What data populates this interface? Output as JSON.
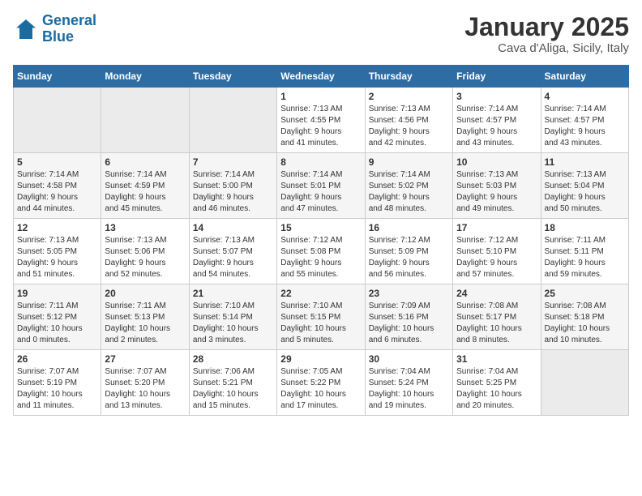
{
  "header": {
    "logo_line1": "General",
    "logo_line2": "Blue",
    "title": "January 2025",
    "subtitle": "Cava d'Aliga, Sicily, Italy"
  },
  "weekdays": [
    "Sunday",
    "Monday",
    "Tuesday",
    "Wednesday",
    "Thursday",
    "Friday",
    "Saturday"
  ],
  "weeks": [
    [
      {
        "day": "",
        "info": ""
      },
      {
        "day": "",
        "info": ""
      },
      {
        "day": "",
        "info": ""
      },
      {
        "day": "1",
        "info": "Sunrise: 7:13 AM\nSunset: 4:55 PM\nDaylight: 9 hours\nand 41 minutes."
      },
      {
        "day": "2",
        "info": "Sunrise: 7:13 AM\nSunset: 4:56 PM\nDaylight: 9 hours\nand 42 minutes."
      },
      {
        "day": "3",
        "info": "Sunrise: 7:14 AM\nSunset: 4:57 PM\nDaylight: 9 hours\nand 43 minutes."
      },
      {
        "day": "4",
        "info": "Sunrise: 7:14 AM\nSunset: 4:57 PM\nDaylight: 9 hours\nand 43 minutes."
      }
    ],
    [
      {
        "day": "5",
        "info": "Sunrise: 7:14 AM\nSunset: 4:58 PM\nDaylight: 9 hours\nand 44 minutes."
      },
      {
        "day": "6",
        "info": "Sunrise: 7:14 AM\nSunset: 4:59 PM\nDaylight: 9 hours\nand 45 minutes."
      },
      {
        "day": "7",
        "info": "Sunrise: 7:14 AM\nSunset: 5:00 PM\nDaylight: 9 hours\nand 46 minutes."
      },
      {
        "day": "8",
        "info": "Sunrise: 7:14 AM\nSunset: 5:01 PM\nDaylight: 9 hours\nand 47 minutes."
      },
      {
        "day": "9",
        "info": "Sunrise: 7:14 AM\nSunset: 5:02 PM\nDaylight: 9 hours\nand 48 minutes."
      },
      {
        "day": "10",
        "info": "Sunrise: 7:13 AM\nSunset: 5:03 PM\nDaylight: 9 hours\nand 49 minutes."
      },
      {
        "day": "11",
        "info": "Sunrise: 7:13 AM\nSunset: 5:04 PM\nDaylight: 9 hours\nand 50 minutes."
      }
    ],
    [
      {
        "day": "12",
        "info": "Sunrise: 7:13 AM\nSunset: 5:05 PM\nDaylight: 9 hours\nand 51 minutes."
      },
      {
        "day": "13",
        "info": "Sunrise: 7:13 AM\nSunset: 5:06 PM\nDaylight: 9 hours\nand 52 minutes."
      },
      {
        "day": "14",
        "info": "Sunrise: 7:13 AM\nSunset: 5:07 PM\nDaylight: 9 hours\nand 54 minutes."
      },
      {
        "day": "15",
        "info": "Sunrise: 7:12 AM\nSunset: 5:08 PM\nDaylight: 9 hours\nand 55 minutes."
      },
      {
        "day": "16",
        "info": "Sunrise: 7:12 AM\nSunset: 5:09 PM\nDaylight: 9 hours\nand 56 minutes."
      },
      {
        "day": "17",
        "info": "Sunrise: 7:12 AM\nSunset: 5:10 PM\nDaylight: 9 hours\nand 57 minutes."
      },
      {
        "day": "18",
        "info": "Sunrise: 7:11 AM\nSunset: 5:11 PM\nDaylight: 9 hours\nand 59 minutes."
      }
    ],
    [
      {
        "day": "19",
        "info": "Sunrise: 7:11 AM\nSunset: 5:12 PM\nDaylight: 10 hours\nand 0 minutes."
      },
      {
        "day": "20",
        "info": "Sunrise: 7:11 AM\nSunset: 5:13 PM\nDaylight: 10 hours\nand 2 minutes."
      },
      {
        "day": "21",
        "info": "Sunrise: 7:10 AM\nSunset: 5:14 PM\nDaylight: 10 hours\nand 3 minutes."
      },
      {
        "day": "22",
        "info": "Sunrise: 7:10 AM\nSunset: 5:15 PM\nDaylight: 10 hours\nand 5 minutes."
      },
      {
        "day": "23",
        "info": "Sunrise: 7:09 AM\nSunset: 5:16 PM\nDaylight: 10 hours\nand 6 minutes."
      },
      {
        "day": "24",
        "info": "Sunrise: 7:08 AM\nSunset: 5:17 PM\nDaylight: 10 hours\nand 8 minutes."
      },
      {
        "day": "25",
        "info": "Sunrise: 7:08 AM\nSunset: 5:18 PM\nDaylight: 10 hours\nand 10 minutes."
      }
    ],
    [
      {
        "day": "26",
        "info": "Sunrise: 7:07 AM\nSunset: 5:19 PM\nDaylight: 10 hours\nand 11 minutes."
      },
      {
        "day": "27",
        "info": "Sunrise: 7:07 AM\nSunset: 5:20 PM\nDaylight: 10 hours\nand 13 minutes."
      },
      {
        "day": "28",
        "info": "Sunrise: 7:06 AM\nSunset: 5:21 PM\nDaylight: 10 hours\nand 15 minutes."
      },
      {
        "day": "29",
        "info": "Sunrise: 7:05 AM\nSunset: 5:22 PM\nDaylight: 10 hours\nand 17 minutes."
      },
      {
        "day": "30",
        "info": "Sunrise: 7:04 AM\nSunset: 5:24 PM\nDaylight: 10 hours\nand 19 minutes."
      },
      {
        "day": "31",
        "info": "Sunrise: 7:04 AM\nSunset: 5:25 PM\nDaylight: 10 hours\nand 20 minutes."
      },
      {
        "day": "",
        "info": ""
      }
    ]
  ]
}
